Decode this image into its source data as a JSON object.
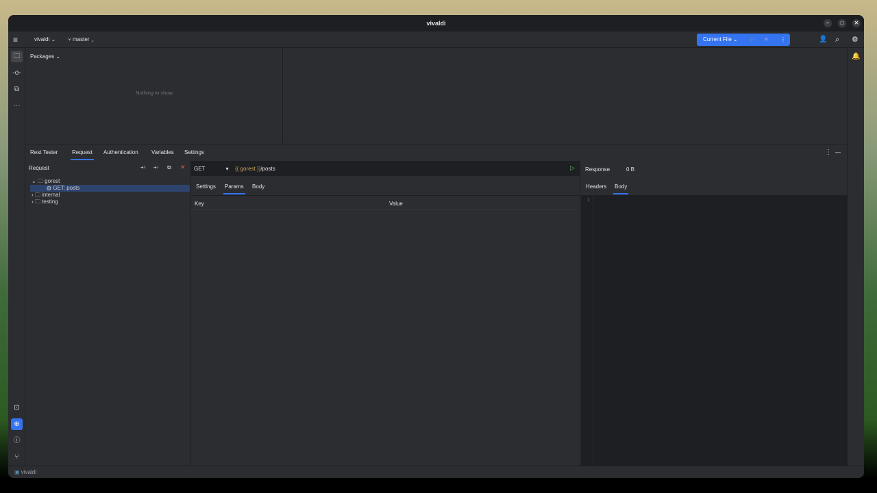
{
  "window": {
    "title": "vivaldi"
  },
  "toolbar": {
    "project": "vivaldi",
    "branch": "master",
    "run_config": "Current File"
  },
  "packages": {
    "title": "Packages",
    "empty": "Nothing to show"
  },
  "tool_window": {
    "title": "Rest Tester",
    "tabs": [
      "Request",
      "Authentication",
      "Variables",
      "Settings"
    ],
    "active_tab": "Request"
  },
  "request_tree": {
    "title": "Request",
    "items": [
      {
        "label": "gorest",
        "type": "folder",
        "expanded": true
      },
      {
        "label": "GET: posts",
        "type": "request",
        "selected": true
      },
      {
        "label": "internal",
        "type": "folder"
      },
      {
        "label": "testing",
        "type": "folder"
      }
    ]
  },
  "request": {
    "method": "GET",
    "url_var": "{{ gorest }}",
    "url_path": "/posts",
    "tabs": [
      "Settings",
      "Params",
      "Body"
    ],
    "active_tab": "Params",
    "columns": [
      "Key",
      "Value"
    ]
  },
  "response": {
    "title": "Response",
    "size": "0 B",
    "tabs": [
      "Headers",
      "Body"
    ],
    "active_tab": "Body",
    "line": "1"
  },
  "status": {
    "project": "vivaldi"
  },
  "colors": {
    "accent": "#3574f0",
    "run": "#5fb865",
    "delete": "#e05555",
    "var": "#c9a060"
  }
}
